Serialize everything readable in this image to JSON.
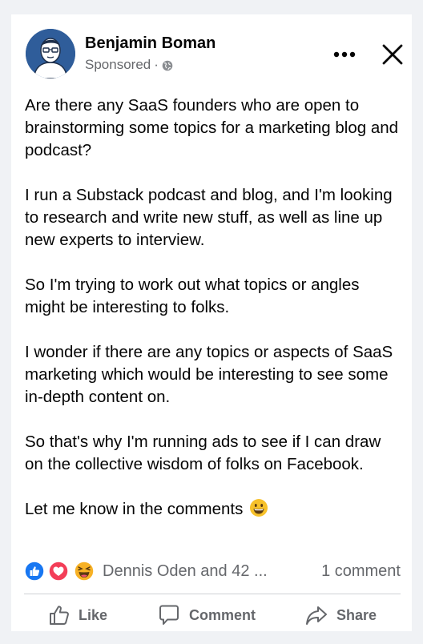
{
  "post": {
    "author": "Benjamin Boman",
    "sponsored_label": "Sponsored",
    "meta_separator": " · ",
    "paragraphs": [
      "Are there any SaaS founders who are open to brainstorming some topics for a marketing blog and podcast?",
      "I run a Substack podcast and blog, and I'm looking to research and write new stuff, as well as line up new experts to interview.",
      "So I'm trying to work out what topics or angles might be interesting to folks.",
      "I wonder if there are any topics or aspects of SaaS marketing which would be interesting to see some in-depth content on.",
      "So that's why I'm running ads to see if I can draw on the collective wisdom of folks on Facebook."
    ],
    "closing_line": "Let me know in the comments",
    "closing_emoji": "grinning-face"
  },
  "reactions": {
    "icons": [
      "like-reaction",
      "love-reaction",
      "haha-reaction"
    ],
    "names_text": "Dennis Oden and 42 ...",
    "comment_count_text": "1 comment"
  },
  "actions": {
    "like_label": "Like",
    "comment_label": "Comment",
    "share_label": "Share"
  },
  "colors": {
    "background": "#f0f2f5",
    "card": "#ffffff",
    "like_blue": "#1877f2",
    "love_red": "#f33e58",
    "haha_yellow": "#f7b125",
    "secondary_text": "#65676b"
  }
}
